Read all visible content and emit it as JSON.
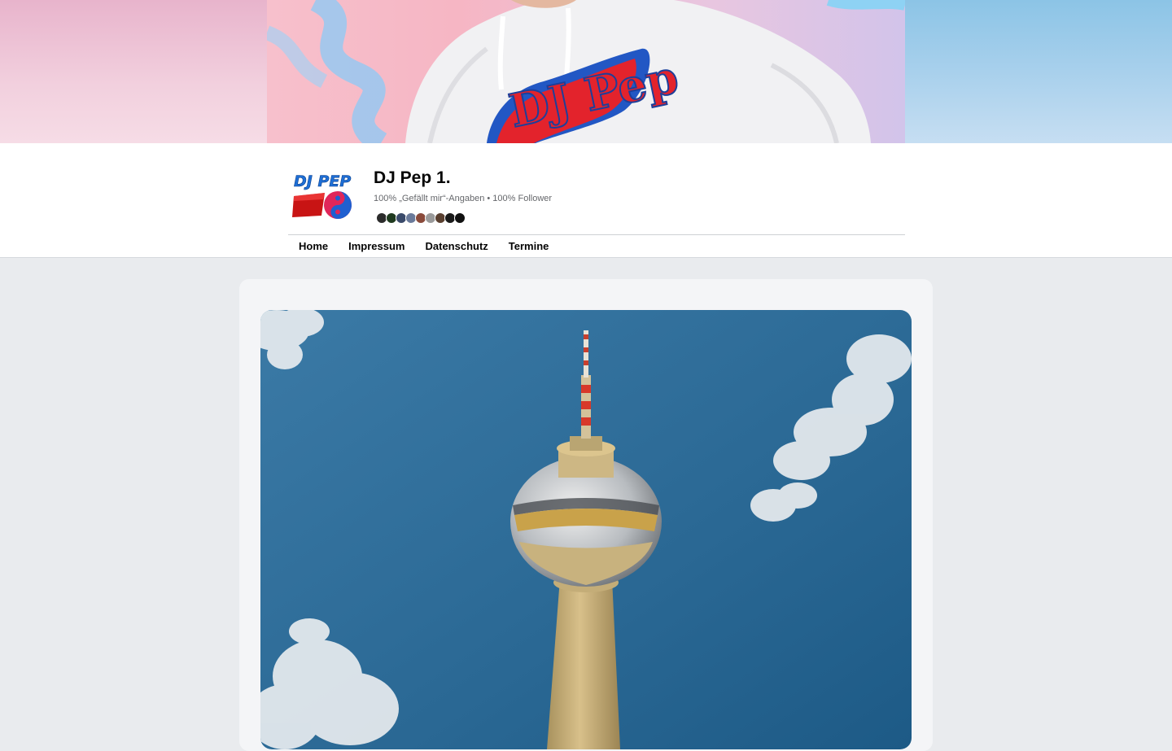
{
  "cover": {
    "hoodie_logo_text": "DJ Pep"
  },
  "profile": {
    "logo_text": "DJ PEP",
    "name": "DJ Pep 1.",
    "stats": "100% „Gefällt mir“-Angaben • 100% Follower",
    "mini_avatars": [
      "#2b2b2b",
      "#1f3a1f",
      "#3a4a6a",
      "#6a7a9a",
      "#8a4a3a",
      "#9a9a9a",
      "#5a4030",
      "#1a1a1a",
      "#111111"
    ]
  },
  "nav": {
    "tabs": [
      "Home",
      "Impressum",
      "Datenschutz",
      "Termine"
    ]
  },
  "colors": {
    "page_bg": "#e9ebee",
    "card_bg": "#f4f5f7",
    "sky": "#2e6a96"
  }
}
